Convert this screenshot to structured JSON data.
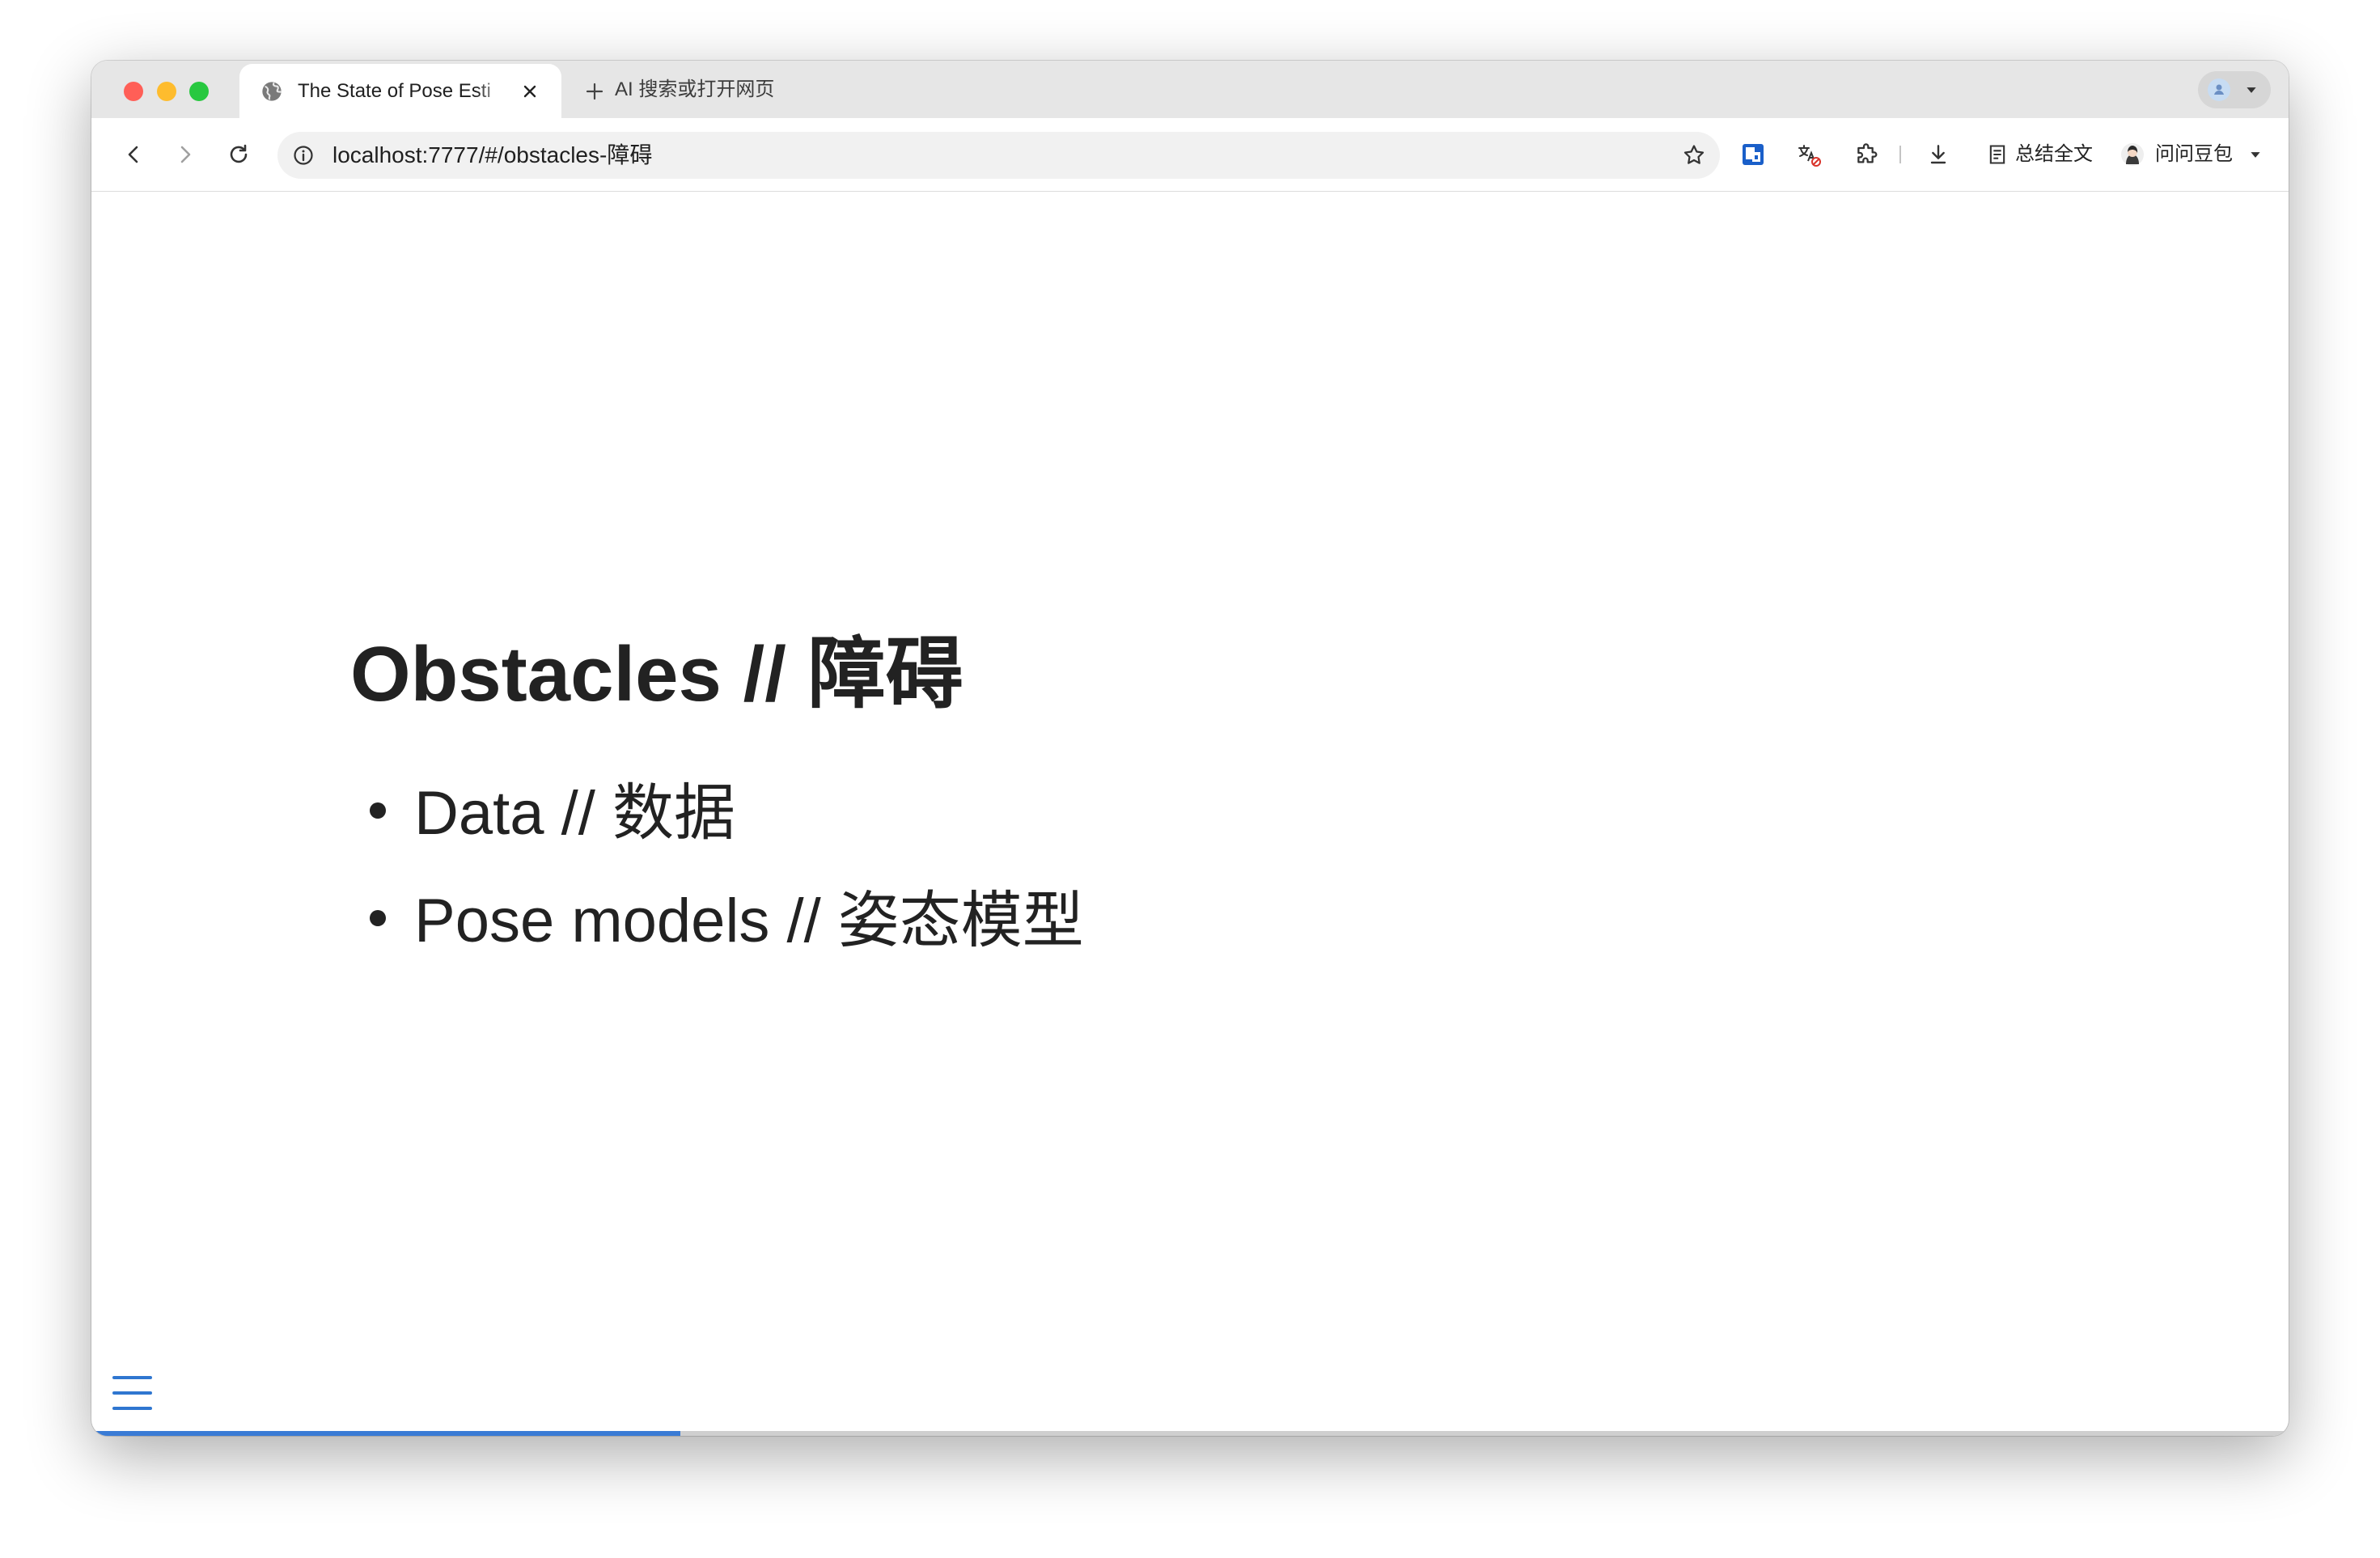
{
  "browser": {
    "tabs": [
      {
        "title": "The State of Pose Esti",
        "active": true,
        "favicon": "globe-icon"
      }
    ],
    "new_tab_label": "AI 搜索或打开网页",
    "address_bar": {
      "url": "localhost:7777/#/obstacles-障碍"
    },
    "toolbar": {
      "summarize_label": "总结全文",
      "doubao_label": "问问豆包"
    }
  },
  "slide": {
    "title": "Obstacles // 障碍",
    "bullets": [
      "Data // 数据",
      "Pose models // 姿态模型"
    ]
  },
  "progress": {
    "fraction": 0.268
  },
  "colors": {
    "accent": "#3a7bd5",
    "text": "#222222",
    "tab_strip": "#e6e6e6",
    "address_bar": "#f1f1f1",
    "close_light": "#ff5f57",
    "minimize_light": "#febc2e",
    "zoom_light": "#28c840"
  },
  "icons": {
    "tab_favicon": "globe-icon",
    "tab_close": "close-icon",
    "new_tab": "plus-icon",
    "nav": [
      "back-arrow-icon",
      "forward-arrow-icon",
      "reload-icon"
    ],
    "address": [
      "info-icon",
      "star-icon"
    ],
    "extensions": [
      "blue-extension-icon",
      "translate-disabled-icon",
      "puzzle-icon",
      "download-icon",
      "summarize-doc-icon"
    ],
    "menu": "hamburger-menu-icon"
  }
}
